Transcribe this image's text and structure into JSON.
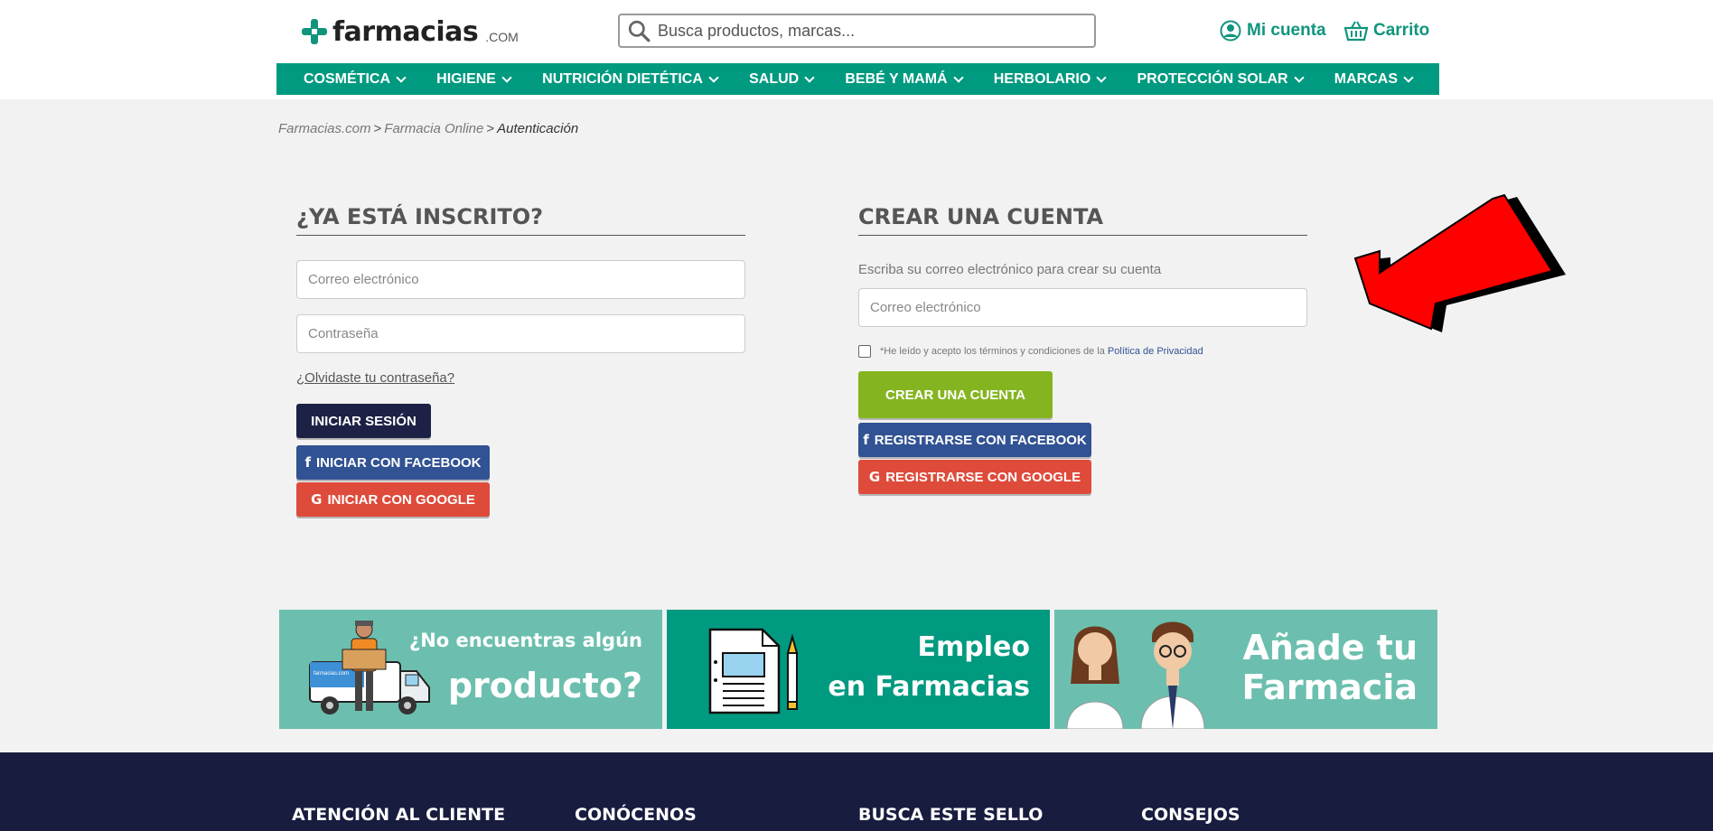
{
  "brand": {
    "name": "farmacias",
    "suffix": ".COM"
  },
  "header": {
    "search_placeholder": "Busca productos, marcas...",
    "account_label": "Mi cuenta",
    "cart_label": "Carrito"
  },
  "nav": {
    "items": [
      {
        "label": "COSMÉTICA"
      },
      {
        "label": "HIGIENE"
      },
      {
        "label": "NUTRICIÓN DIETÉTICA"
      },
      {
        "label": "SALUD"
      },
      {
        "label": "BEBÉ Y MAMÁ"
      },
      {
        "label": "HERBOLARIO"
      },
      {
        "label": "PROTECCIÓN SOLAR"
      },
      {
        "label": "MARCAS"
      }
    ]
  },
  "breadcrumb": {
    "items": [
      "Farmacias.com",
      "Farmacia Online",
      "Autenticación"
    ],
    "separator": ">"
  },
  "login": {
    "title": "¿YA ESTÁ INSCRITO?",
    "email_placeholder": "Correo electrónico",
    "password_placeholder": "Contraseña",
    "forgot_label": "¿Olvidaste tu contraseña?",
    "submit_label": "INICIAR SESIÓN",
    "facebook_label": "INICIAR CON FACEBOOK",
    "google_label": "INICIAR CON GOOGLE"
  },
  "register": {
    "title": "CREAR UNA CUENTA",
    "hint": "Escriba su correo electrónico para crear su cuenta",
    "email_placeholder": "Correo electrónico",
    "terms_text": "*He leído y acepto los términos y condiciones de la",
    "terms_link": "Política de Privacidad",
    "terms_checked": false,
    "submit_label": "CREAR UNA CUENTA",
    "facebook_label": "REGISTRARSE CON FACEBOOK",
    "google_label": "REGISTRARSE CON GOOGLE"
  },
  "banners": [
    {
      "line1": "¿No encuentras algún",
      "line2": "producto?",
      "van_text": "farmacias.com",
      "bg": "#6cbfae"
    },
    {
      "line1": "Empleo",
      "line2": "en Farmacias",
      "bg": "#009a80"
    },
    {
      "line1": "Añade tu",
      "line2": "Farmacia",
      "bg": "#6cbfae"
    }
  ],
  "footer": {
    "columns": [
      "ATENCIÓN AL CLIENTE",
      "CONÓCENOS",
      "BUSCA ESTE SELLO",
      "CONSEJOS"
    ]
  },
  "colors": {
    "brand_green": "#009a80",
    "navy": "#1c2145",
    "facebook": "#315293",
    "google": "#de4b3b",
    "create_green": "#84b521",
    "arrow_red": "#ff0000",
    "footer_bg": "#181c3f"
  },
  "icons": {
    "search": "search-icon",
    "account": "user-circle-icon",
    "cart": "basket-icon",
    "facebook": "facebook-icon",
    "google": "google-icon",
    "chevron": "chevron-down-icon"
  }
}
